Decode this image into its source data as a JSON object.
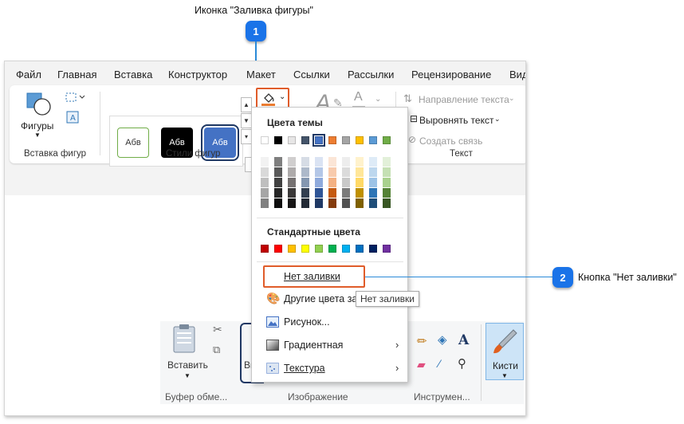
{
  "callouts": [
    {
      "number": "1",
      "text": "Иконка \"Заливка фигуры\""
    },
    {
      "number": "2",
      "text": "Кнопка \"Нет заливки\""
    }
  ],
  "menu": [
    "Файл",
    "Главная",
    "Вставка",
    "Конструктор",
    "Макет",
    "Ссылки",
    "Рассылки",
    "Рецензирование",
    "Вид"
  ],
  "ribbon": {
    "shapes_button": "Фигуры",
    "group_insert_shapes": "Вставка фигур",
    "style_samples": [
      "Абв",
      "Абв",
      "Абв"
    ],
    "group_shape_styles": "Стили фигур",
    "text_direction": "Направление текста",
    "align_text": "Выровнять текст",
    "create_link": "Создать связь",
    "group_text": "Текст"
  },
  "paint": {
    "paste": "Вставить",
    "clipboard_group": "Буфер обме...",
    "select_partial": "Выд",
    "image_group": "Изображение",
    "tools_group": "Инструмен...",
    "brushes": "Кисти"
  },
  "dropdown": {
    "theme_colors_title": "Цвета темы",
    "standard_colors_title": "Стандартные цвета",
    "theme_top": [
      "#ffffff",
      "#000000",
      "#e7e6e6",
      "#44546a",
      "#4472c4",
      "#ed7d31",
      "#a5a5a5",
      "#ffc000",
      "#5b9bd5",
      "#70ad47"
    ],
    "theme_shades": [
      [
        "#f2f2f2",
        "#d9d9d9",
        "#bfbfbf",
        "#a6a6a6",
        "#808080"
      ],
      [
        "#7f7f7f",
        "#595959",
        "#404040",
        "#262626",
        "#0d0d0d"
      ],
      [
        "#d0cece",
        "#aeabab",
        "#757171",
        "#3a3838",
        "#171616"
      ],
      [
        "#d6dce5",
        "#adb9ca",
        "#8497b0",
        "#333f50",
        "#222a35"
      ],
      [
        "#dae3f3",
        "#b4c7e7",
        "#8faadc",
        "#2f5597",
        "#1f3864"
      ],
      [
        "#fbe5d6",
        "#f8cbad",
        "#f4b183",
        "#c55a11",
        "#843c0c"
      ],
      [
        "#ededed",
        "#dbdbdb",
        "#c9c9c9",
        "#7b7b7b",
        "#525252"
      ],
      [
        "#fff2cc",
        "#ffe699",
        "#ffd966",
        "#bf9000",
        "#7f6000"
      ],
      [
        "#deebf7",
        "#bdd7ee",
        "#9dc3e6",
        "#2e75b6",
        "#1f4e79"
      ],
      [
        "#e2f0d9",
        "#c5e0b4",
        "#a9d18e",
        "#548235",
        "#385723"
      ]
    ],
    "standard": [
      "#c00000",
      "#ff0000",
      "#ffc000",
      "#ffff00",
      "#92d050",
      "#00b050",
      "#00b0f0",
      "#0070c0",
      "#002060",
      "#7030a0"
    ],
    "no_fill": "Нет заливки",
    "more_colors": "Другие цвета заливки...",
    "picture": "Рисунок...",
    "gradient": "Градиентная",
    "texture": "Текстура"
  },
  "tooltip": "Нет заливки"
}
